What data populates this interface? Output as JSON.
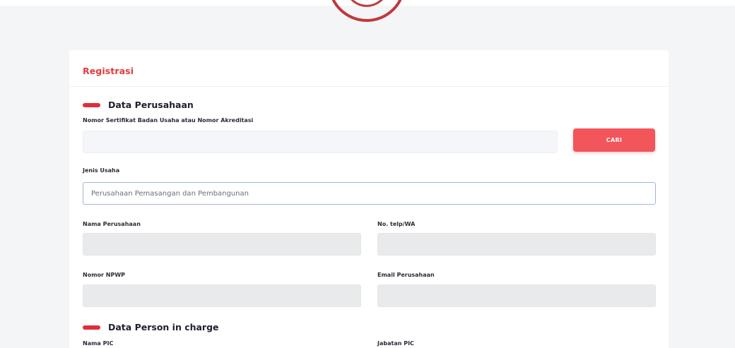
{
  "header": {
    "title": "Registrasi"
  },
  "sections": {
    "company": {
      "title": "Data Perusahaan"
    },
    "pic": {
      "title": "Data Person in charge"
    }
  },
  "fields": {
    "certificate": {
      "label": "Nomor Sertifikat Badan Usaha atau Nomor Akreditasi",
      "value": ""
    },
    "search_button": "CARI",
    "business_type": {
      "label": "Jenis Usaha",
      "value": "Perusahaan Pemasangan dan Pembangunan"
    },
    "company_name": {
      "label": "Nama Perusahaan",
      "value": ""
    },
    "phone": {
      "label": "No. telp/WA",
      "value": ""
    },
    "npwp": {
      "label": "Nomor NPWP",
      "value": ""
    },
    "email": {
      "label": "Email Perusahaan",
      "value": ""
    },
    "pic_name": {
      "label": "Nama PIC"
    },
    "pic_position": {
      "label": "Jabatan PIC"
    }
  },
  "colors": {
    "accent": "#e23b3b",
    "button": "#f2555a",
    "background": "#f4f5f7"
  },
  "icons": {
    "logo": "logo-arc-icon",
    "section_marker": "section-bar-icon"
  }
}
